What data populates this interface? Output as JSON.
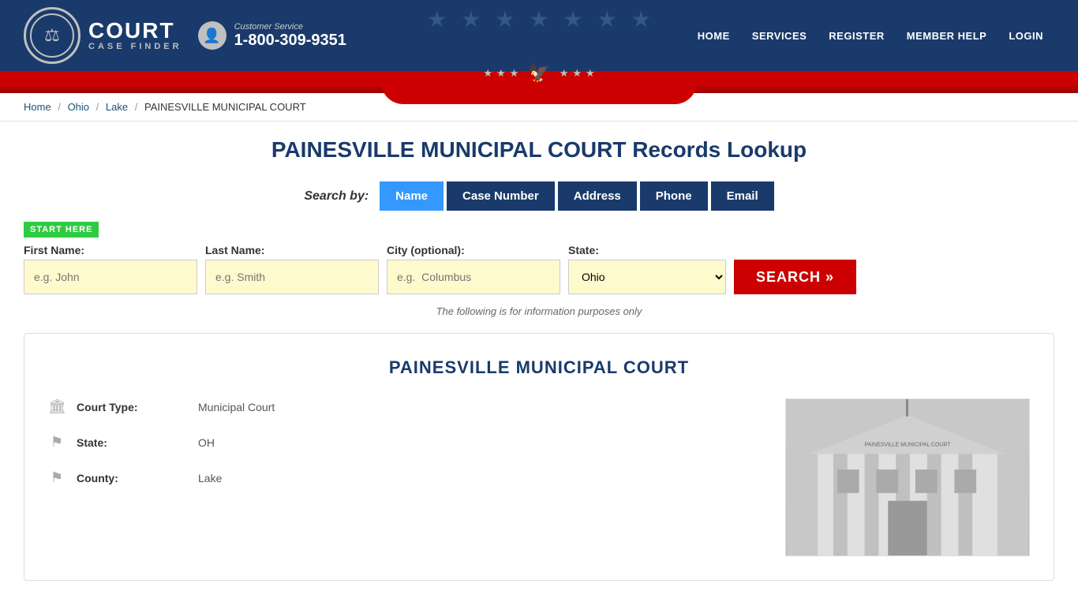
{
  "header": {
    "logo_court": "COURT",
    "logo_case_finder": "CASE FINDER",
    "customer_service_label": "Customer Service",
    "customer_service_phone": "1-800-309-9351",
    "nav_items": [
      "HOME",
      "SERVICES",
      "REGISTER",
      "MEMBER HELP",
      "LOGIN"
    ]
  },
  "breadcrumb": {
    "home": "Home",
    "ohio": "Ohio",
    "lake": "Lake",
    "current": "PAINESVILLE MUNICIPAL COURT"
  },
  "page": {
    "title": "PAINESVILLE MUNICIPAL COURT Records Lookup",
    "info_note": "The following is for information purposes only"
  },
  "search": {
    "search_by_label": "Search by:",
    "tabs": [
      {
        "id": "name",
        "label": "Name",
        "active": true
      },
      {
        "id": "case-number",
        "label": "Case Number",
        "active": false
      },
      {
        "id": "address",
        "label": "Address",
        "active": false
      },
      {
        "id": "phone",
        "label": "Phone",
        "active": false
      },
      {
        "id": "email",
        "label": "Email",
        "active": false
      }
    ],
    "start_here_badge": "START HERE",
    "first_name_label": "First Name:",
    "first_name_placeholder": "e.g. John",
    "last_name_label": "Last Name:",
    "last_name_placeholder": "e.g. Smith",
    "city_label": "City (optional):",
    "city_placeholder": "e.g.  Columbus",
    "state_label": "State:",
    "state_value": "Ohio",
    "search_button": "SEARCH »"
  },
  "court_info": {
    "title": "PAINESVILLE MUNICIPAL COURT",
    "court_type_label": "Court Type:",
    "court_type_value": "Municipal Court",
    "state_label": "State:",
    "state_value": "OH",
    "county_label": "County:",
    "county_value": "Lake"
  },
  "icons": {
    "building_icon": "🏛",
    "flag_gray_icon": "⚑",
    "location_icon": "📍",
    "phone_icon": "☎",
    "headset_icon": "👤"
  }
}
